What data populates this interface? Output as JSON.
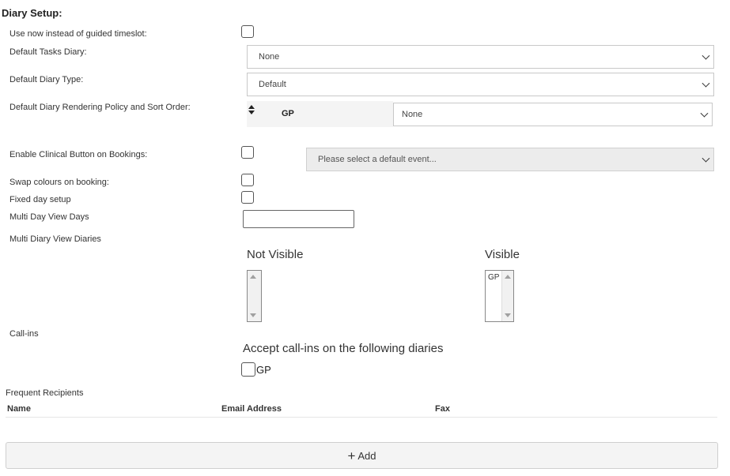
{
  "section_title": "Diary Setup:",
  "fields": {
    "use_now_label": "Use now instead of guided timeslot:",
    "default_tasks_diary_label": "Default Tasks Diary:",
    "default_tasks_diary_value": "None",
    "default_diary_type_label": "Default Diary Type:",
    "default_diary_type_value": "Default",
    "rendering_policy_label": "Default Diary Rendering Policy and Sort Order:",
    "rendering_policy_row_name": "GP",
    "rendering_policy_value": "None",
    "enable_clinical_label": "Enable Clinical Button on Bookings:",
    "default_event_placeholder": "Please select a default event...",
    "swap_colours_label": "Swap colours on booking:",
    "fixed_day_label": "Fixed day setup",
    "multi_day_view_days_label": "Multi Day View Days",
    "multi_day_view_days_value": "",
    "multi_diary_view_label": "Multi Diary View Diaries"
  },
  "diary_lists": {
    "not_visible_heading": "Not Visible",
    "not_visible_items": [],
    "visible_heading": "Visible",
    "visible_items": [
      "GP"
    ]
  },
  "callins": {
    "label": "Call-ins",
    "heading": "Accept call-ins on the following diaries",
    "diaries": [
      {
        "name": "GP",
        "checked": false
      }
    ]
  },
  "recipients": {
    "title": "Frequent Recipients",
    "columns": [
      "Name",
      "Email Address",
      "Fax"
    ],
    "rows": []
  },
  "add_button": {
    "label": "Add",
    "icon": "plus-icon"
  }
}
